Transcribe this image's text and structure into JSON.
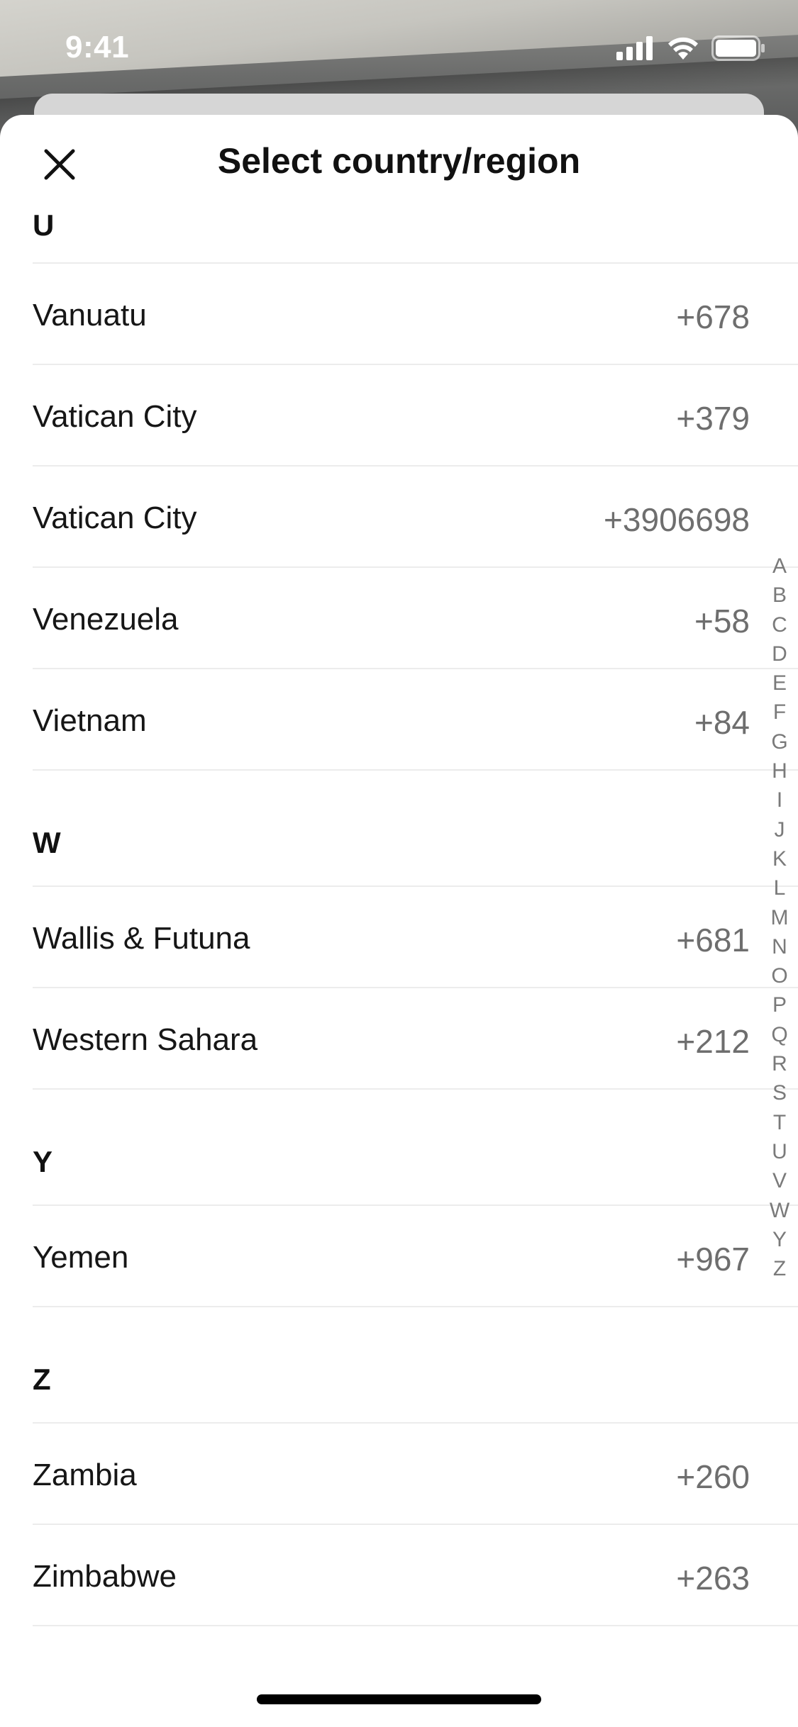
{
  "status_bar": {
    "time": "9:41",
    "icons": [
      "cellular-signal-icon",
      "wifi-icon",
      "battery-icon"
    ]
  },
  "sheet": {
    "title": "Select country/region",
    "close_icon": "close-icon"
  },
  "sections": [
    {
      "letter": "U",
      "items": [
        {
          "name": "Vanuatu",
          "code": "+678"
        },
        {
          "name": "Vatican City",
          "code": "+379"
        },
        {
          "name": "Vatican City",
          "code": "+3906698"
        },
        {
          "name": "Venezuela",
          "code": "+58"
        },
        {
          "name": "Vietnam",
          "code": "+84"
        }
      ]
    },
    {
      "letter": "W",
      "items": [
        {
          "name": "Wallis & Futuna",
          "code": "+681"
        },
        {
          "name": "Western Sahara",
          "code": "+212"
        }
      ]
    },
    {
      "letter": "Y",
      "items": [
        {
          "name": "Yemen",
          "code": "+967"
        }
      ]
    },
    {
      "letter": "Z",
      "items": [
        {
          "name": "Zambia",
          "code": "+260"
        },
        {
          "name": "Zimbabwe",
          "code": "+263"
        }
      ]
    }
  ],
  "index_letters": [
    "A",
    "B",
    "C",
    "D",
    "E",
    "F",
    "G",
    "H",
    "I",
    "J",
    "K",
    "L",
    "M",
    "N",
    "O",
    "P",
    "Q",
    "R",
    "S",
    "T",
    "U",
    "V",
    "W",
    "Y",
    "Z"
  ],
  "colors": {
    "sheet_background": "#ffffff",
    "primary_text": "#161616",
    "secondary_text": "#6e6e6e",
    "divider": "#ececec",
    "index_text": "#7a7a7a"
  }
}
